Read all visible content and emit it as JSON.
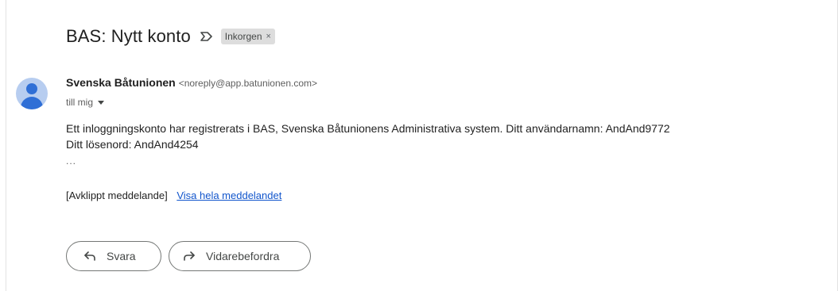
{
  "email": {
    "subject": "BAS: Nytt konto",
    "label_chip": {
      "text": "Inkorgen",
      "close": "×"
    },
    "sender": {
      "name": "Svenska Båtunionen",
      "email": "<noreply@app.batunionen.com>"
    },
    "recipient_line": "till mig",
    "body_lines": [
      "Ett inloggningskonto har registrerats i BAS, Svenska Båtunionens Administrativa system. Ditt användarnamn: AndAnd9772",
      "Ditt lösenord: AndAnd4254"
    ],
    "ellipsis": "...",
    "clipped_notice": "[Avklippt meddelande]",
    "view_full_link": "Visa hela meddelandet"
  },
  "actions": {
    "reply_label": "Svara",
    "forward_label": "Vidarebefordra"
  },
  "icons": {
    "importance": "importance-marker-icon",
    "avatar": "default-avatar-icon",
    "reply": "reply-arrow-icon",
    "forward": "forward-arrow-icon",
    "dropdown": "caret-down-icon"
  },
  "colors": {
    "avatar_bg": "#b7cdf0",
    "avatar_fg": "#2f6fd6",
    "link": "#1155cc",
    "chip_bg": "#dddddd"
  }
}
